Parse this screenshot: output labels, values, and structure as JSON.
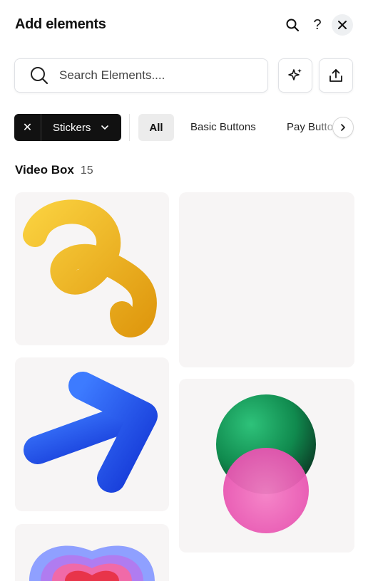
{
  "header": {
    "title": "Add elements",
    "search_icon": "search-icon",
    "help_label": "?",
    "close_icon": "close-icon"
  },
  "search": {
    "placeholder": "Search Elements....",
    "value": ""
  },
  "toolbar": {
    "ai_icon": "sparkle-icon",
    "upload_icon": "upload-icon"
  },
  "filters": {
    "active_filter": {
      "remove_label": "✕",
      "label": "Stickers"
    },
    "chips": [
      {
        "label": "All",
        "selected": true
      },
      {
        "label": "Basic Buttons",
        "selected": false
      },
      {
        "label": "Pay Buttons",
        "selected": false
      }
    ],
    "next_icon": "chevron-right-icon"
  },
  "section": {
    "title": "Video Box",
    "count": "15"
  },
  "items": [
    {
      "name": "yellow-squiggle-sticker",
      "color": "#f2b51f"
    },
    {
      "name": "empty-placeholder",
      "color": "#f7f5f5"
    },
    {
      "name": "blue-arrow-sticker",
      "color": "#1f5bf0"
    },
    {
      "name": "green-pink-spheres-sticker",
      "color": "#1a9a5c"
    },
    {
      "name": "rainbow-heart-sticker",
      "color": "#7c6cf0"
    }
  ]
}
